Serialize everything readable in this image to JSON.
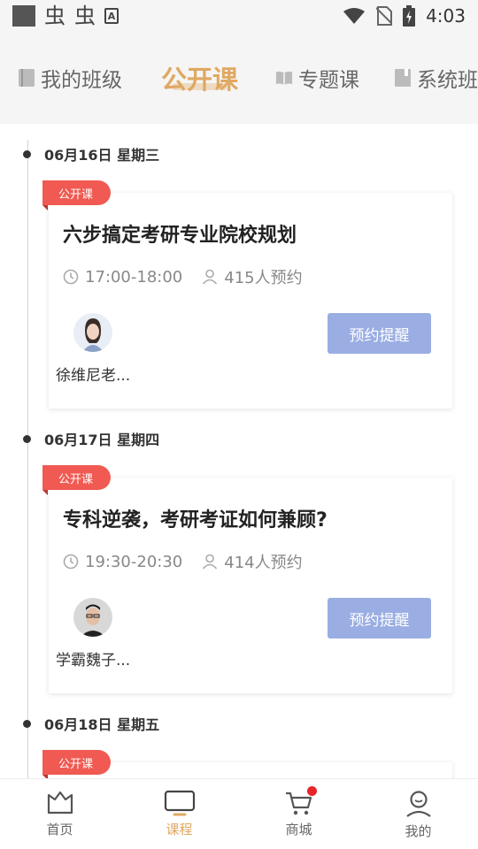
{
  "status_bar": {
    "glyph_1": "虫",
    "glyph_2": "虫",
    "a_icon": "A",
    "time": "4:03"
  },
  "top_tabs": [
    {
      "label": "我的班级",
      "icon": "notebook-icon",
      "active": false
    },
    {
      "label": "公开课",
      "icon": "",
      "active": true
    },
    {
      "label": "专题课",
      "icon": "open-book-icon",
      "active": false
    },
    {
      "label": "系统班",
      "icon": "book-icon",
      "active": false
    }
  ],
  "schedule": [
    {
      "date": "06月16日 星期三",
      "badge": "公开课",
      "title": "六步搞定考研专业院校规划",
      "time": "17:00-18:00",
      "reservations": "415人预约",
      "teacher": "徐维尼老...",
      "button": "预约提醒"
    },
    {
      "date": "06月17日 星期四",
      "badge": "公开课",
      "title": "专科逆袭，考研考证如何兼顾?",
      "time": "19:30-20:30",
      "reservations": "414人预约",
      "teacher": "学霸魏子...",
      "button": "预约提醒"
    },
    {
      "date": "06月18日 星期五",
      "badge": "公开课"
    }
  ],
  "bottom_nav": [
    {
      "label": "首页",
      "icon": "home-crown-icon",
      "active": false
    },
    {
      "label": "课程",
      "icon": "tv-icon",
      "active": true
    },
    {
      "label": "商城",
      "icon": "cart-icon",
      "active": false,
      "has_dot": true
    },
    {
      "label": "我的",
      "icon": "person-icon",
      "active": false
    }
  ],
  "colors": {
    "accent": "#e0a862",
    "badge": "#f05a52",
    "button": "#9aaee3",
    "notification_dot": "#e8242b"
  }
}
